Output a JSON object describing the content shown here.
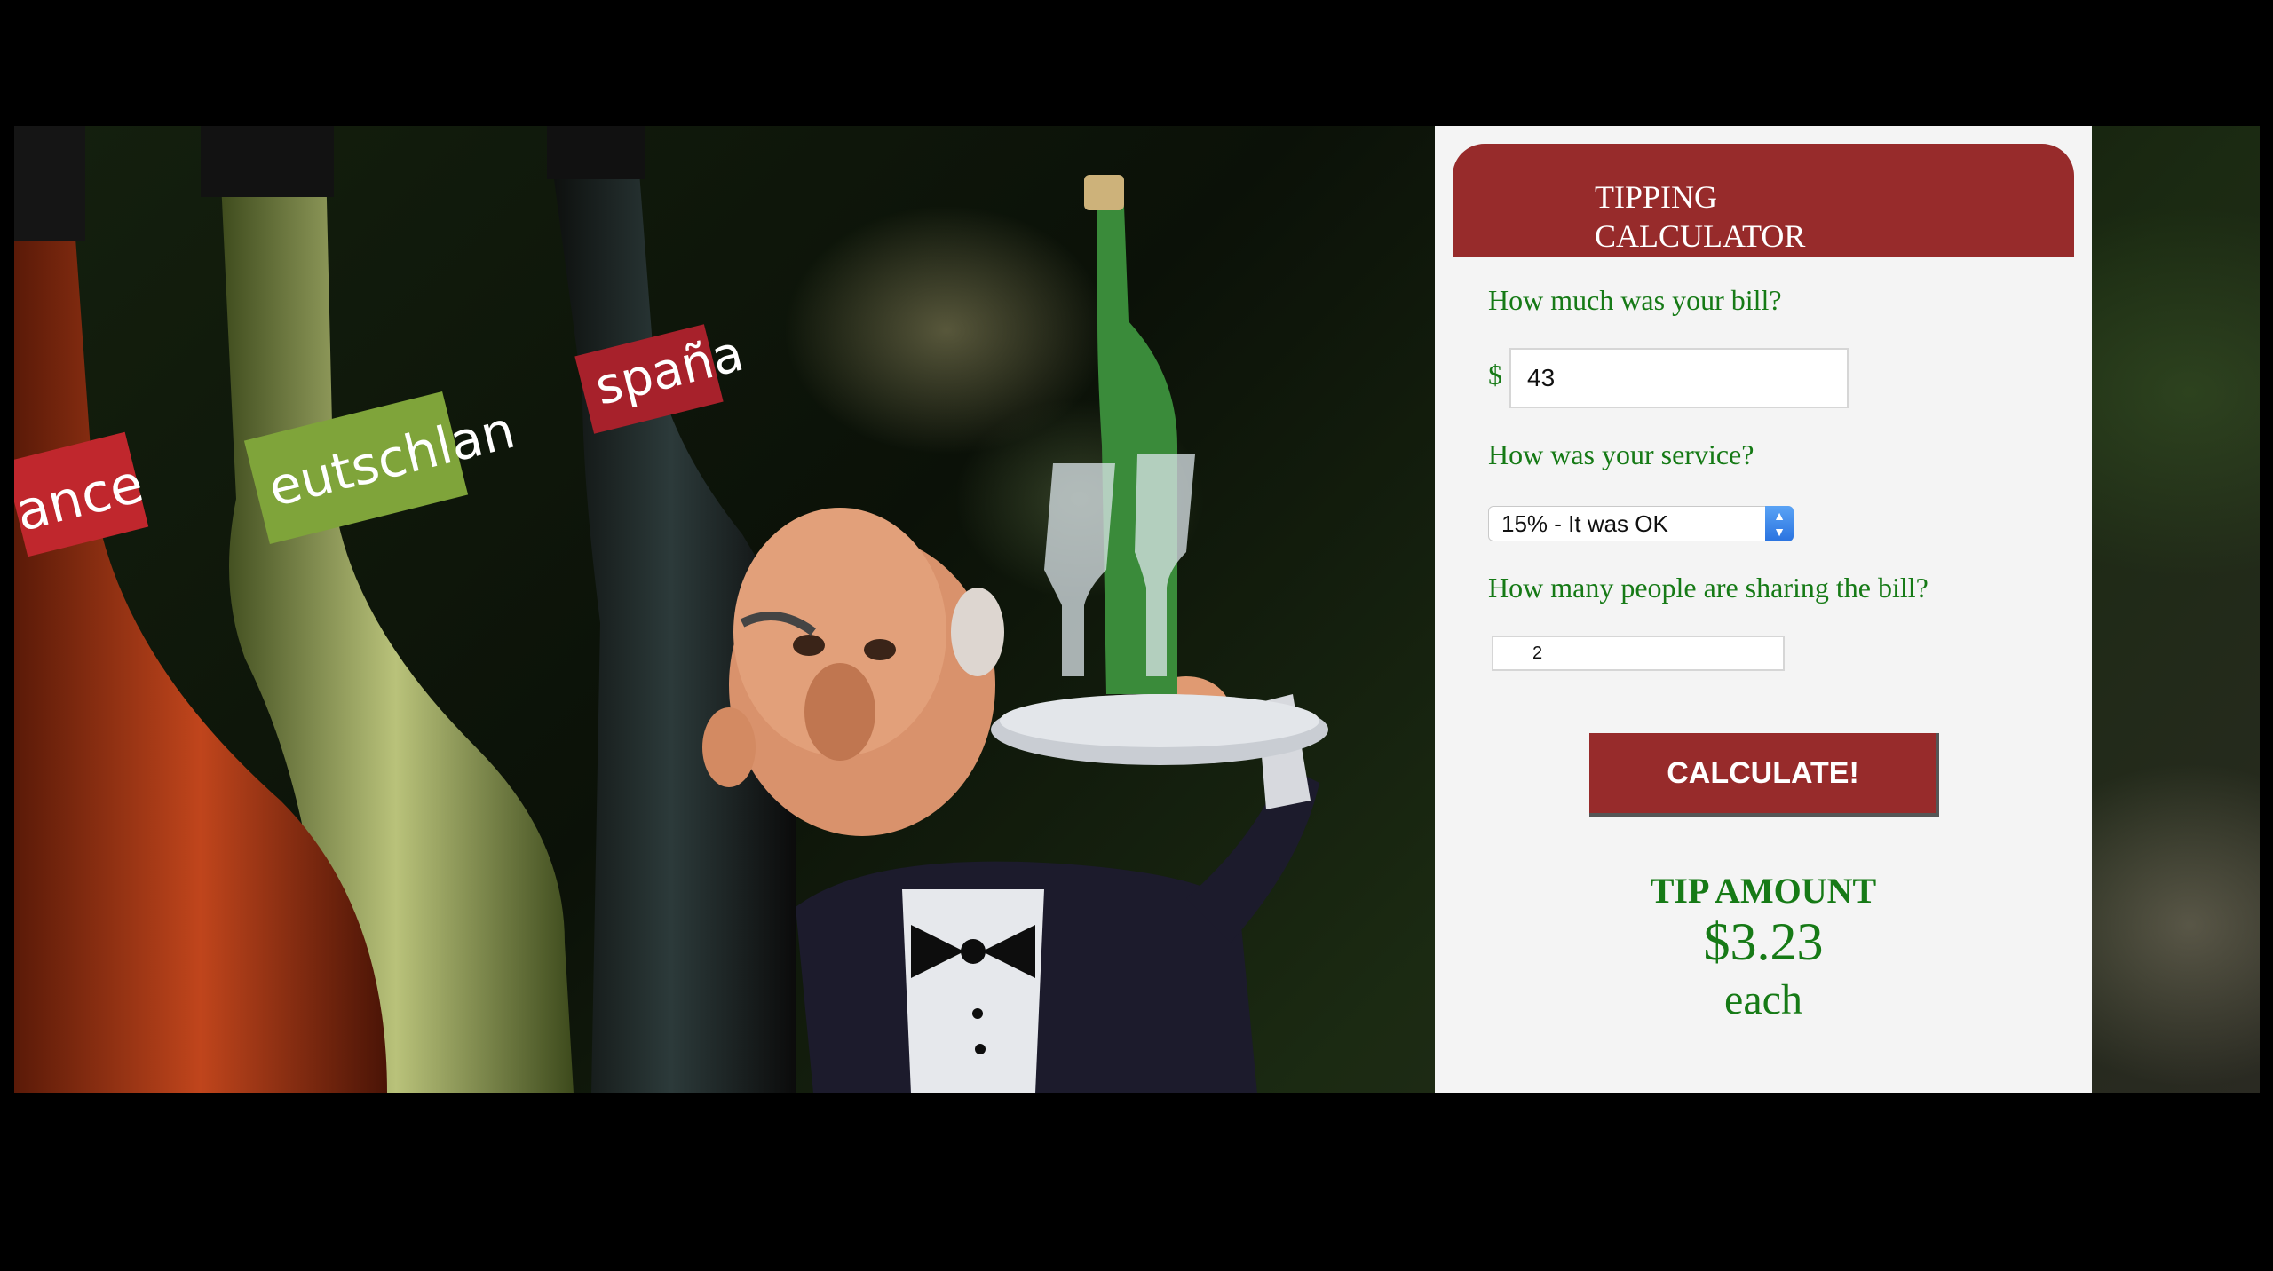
{
  "panel": {
    "title": "TIPPING CALCULATOR",
    "bill_question": "How much was your bill?",
    "currency": "$",
    "bill_value": "43",
    "service_question": "How was your service?",
    "service_selected": "15% - It was OK",
    "people_question": "How many people are sharing the bill?",
    "people_value": "2",
    "calculate_label": "CALCULATE!",
    "tip_label": "TIP AMOUNT",
    "tip_value": "$3.23",
    "tip_suffix": "each"
  },
  "photo": {
    "label_left": "ance",
    "label_middle": "eutschlan",
    "label_right": "spaña"
  },
  "colors": {
    "accent": "#972b2b",
    "text_green": "#167a16",
    "panel_bg": "#f4f4f4"
  }
}
